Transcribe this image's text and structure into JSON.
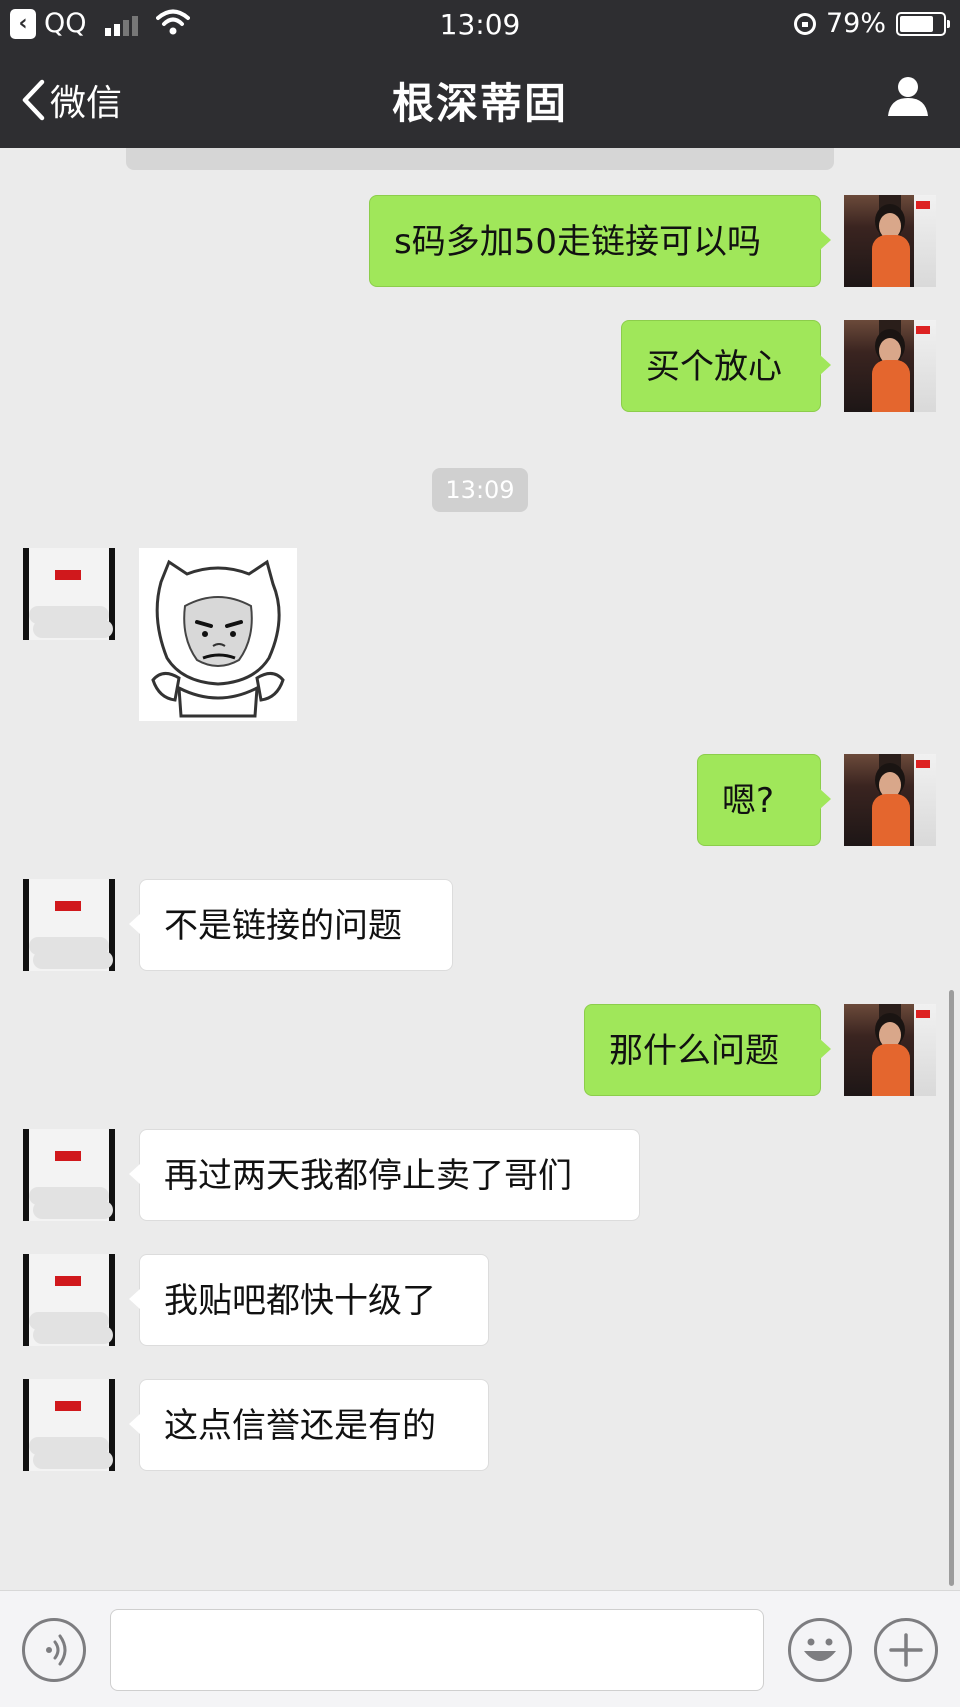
{
  "status_bar": {
    "back_app": "QQ",
    "time": "13:09",
    "battery": "79%",
    "battery_level": 0.79
  },
  "nav": {
    "back_label": "微信",
    "title": "根深蒂固"
  },
  "time_divider": "13:09",
  "messages": [
    {
      "from": "me",
      "text": "s码多加50走链接可以吗"
    },
    {
      "from": "me",
      "text": "买个放心"
    },
    {
      "from": "them",
      "type": "sticker",
      "icon": "face-meme-sticker"
    },
    {
      "from": "me",
      "text": "嗯?"
    },
    {
      "from": "them",
      "text": "不是链接的问题"
    },
    {
      "from": "me",
      "text": "那什么问题"
    },
    {
      "from": "them",
      "text": "再过两天我都停止卖了哥们"
    },
    {
      "from": "them",
      "text": "我贴吧都快十级了"
    },
    {
      "from": "them",
      "text": "这点信誉还是有的"
    }
  ],
  "input": {
    "value": "",
    "placeholder": ""
  },
  "icons": {
    "voice": "voice-icon",
    "emoji": "emoji-icon",
    "plus": "plus-icon",
    "profile": "profile-icon",
    "back": "chevron-left-icon"
  },
  "colors": {
    "bar_bg": "#2e2e31",
    "chat_bg": "#ebebeb",
    "my_bubble": "#a0e75a",
    "their_bubble": "#ffffff"
  }
}
